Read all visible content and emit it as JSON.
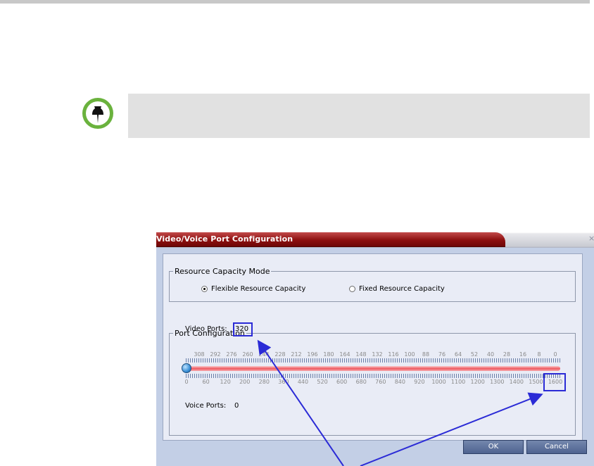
{
  "dialog": {
    "title": "Video/Voice Port Configuration",
    "close_glyph": "×",
    "resource_capacity_mode": {
      "legend": "Resource Capacity Mode",
      "options": [
        {
          "label": "Flexible Resource Capacity",
          "selected": true
        },
        {
          "label": "Fixed Resource Capacity",
          "selected": false
        }
      ]
    },
    "port_configuration": {
      "legend": "Port Configuration",
      "video_ports_label": "Video Ports:",
      "video_ports_value": "320",
      "voice_ports_label": "Voice Ports:",
      "voice_ports_value": "0",
      "slider_position_fraction": 0,
      "video_scale": [
        "308",
        "292",
        "276",
        "260",
        "244",
        "228",
        "212",
        "196",
        "180",
        "164",
        "148",
        "132",
        "116",
        "100",
        "88",
        "76",
        "64",
        "52",
        "40",
        "28",
        "16",
        "8",
        "0"
      ],
      "voice_scale": [
        "0",
        "60",
        "120",
        "200",
        "280",
        "360",
        "440",
        "520",
        "600",
        "680",
        "760",
        "840",
        "920",
        "1000",
        "1100",
        "1200",
        "1300",
        "1400",
        "1500",
        "1600"
      ]
    },
    "buttons": {
      "ok": "OK",
      "cancel": "Cancel"
    }
  },
  "colors": {
    "annotation_blue": "#2b2bd6",
    "note_icon_green": "#6ab23d",
    "slider_track": "#ef5a60",
    "title_bar_red": "#8d1010"
  },
  "icons": {
    "note": "pushpin-icon"
  }
}
